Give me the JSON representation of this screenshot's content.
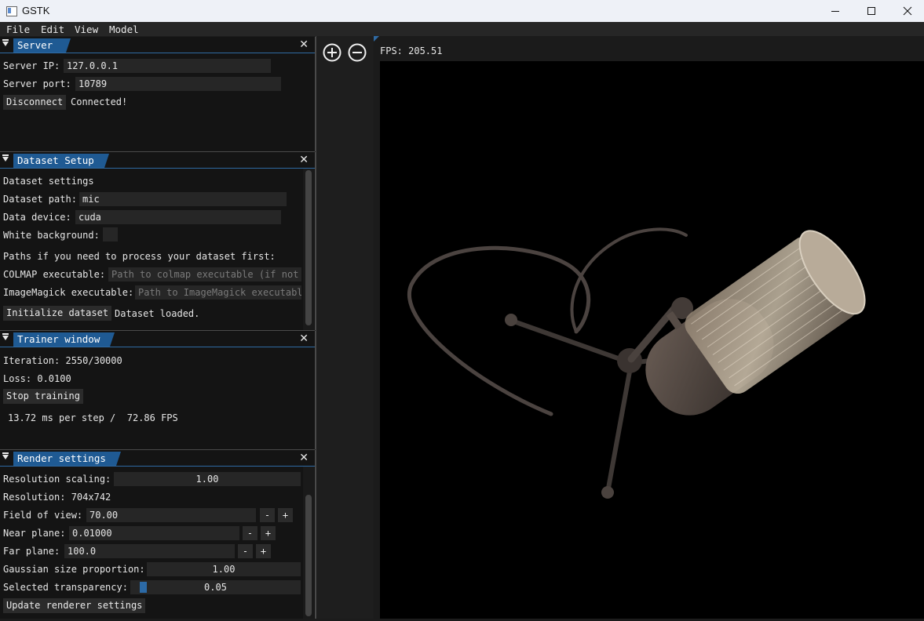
{
  "window": {
    "title": "GSTK"
  },
  "menu": {
    "items": [
      "File",
      "Edit",
      "View",
      "Model"
    ]
  },
  "server": {
    "tab": "Server",
    "ip_label": "Server IP:",
    "ip_value": "127.0.0.1",
    "port_label": "Server port:",
    "port_value": "10789",
    "disconnect_label": "Disconnect",
    "status": "Connected!"
  },
  "dataset": {
    "tab": "Dataset Setup",
    "settings_heading": "Dataset settings",
    "path_label": "Dataset path:",
    "path_value": "mic",
    "device_label": "Data device:",
    "device_value": "cuda",
    "white_bg_label": "White background:",
    "process_heading": "Paths if you need to process your dataset first:",
    "colmap_label": "COLMAP executable:",
    "colmap_placeholder": "Path to colmap executable (if not i",
    "imagemagick_label": "ImageMagick executable:",
    "imagemagick_placeholder": "Path to ImageMagick executable",
    "init_label": "Initialize dataset",
    "status": "Dataset loaded."
  },
  "trainer": {
    "tab": "Trainer window",
    "iteration": "Iteration: 2550/30000",
    "loss": "Loss: 0.0100",
    "stop_label": "Stop training",
    "timing": "13.72 ms per step /  72.86 FPS"
  },
  "render": {
    "tab": "Render settings",
    "res_scaling_label": "Resolution scaling:",
    "res_scaling_value": "1.00",
    "resolution": "Resolution: 704x742",
    "fov_label": "Field of view:",
    "fov_value": "70.00",
    "near_label": "Near plane:",
    "near_value": "0.01000",
    "far_label": "Far plane:",
    "far_value": "100.0",
    "gauss_label": "Gaussian size proportion:",
    "gauss_value": "1.00",
    "transp_label": "Selected transparency:",
    "transp_value": "0.05",
    "transp_fraction": 0.05,
    "minus": "-",
    "plus": "+",
    "update_label": "Update renderer settings"
  },
  "viewport": {
    "fps": "FPS: 205.51"
  }
}
